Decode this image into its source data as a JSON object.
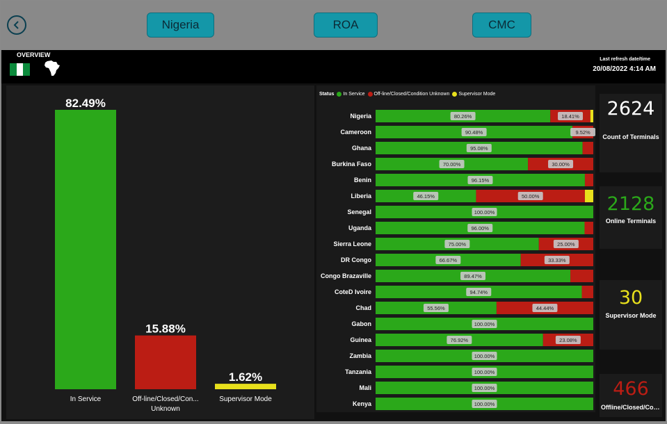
{
  "nav": {
    "buttons": [
      {
        "label": "Nigeria"
      },
      {
        "label": "ROA"
      },
      {
        "label": "CMC"
      }
    ]
  },
  "header": {
    "title": "OVERVIEW",
    "refresh_label": "Last refresh date/time",
    "refresh_value": "20/08/2022 4:14 AM"
  },
  "colors": {
    "in_service": "#2ba81a",
    "offline": "#bb1d14",
    "supervisor": "#e8e01c",
    "flag_green": "#0c8a3c",
    "background": "#111111"
  },
  "chart_data": [
    {
      "type": "bar",
      "categories": [
        "In Service",
        "Off-line/Closed/Con... Unknown",
        "Supervisor Mode"
      ],
      "values": [
        82.49,
        15.88,
        1.62
      ],
      "value_labels": [
        "82.49%",
        "15.88%",
        "1.62%"
      ]
    },
    {
      "type": "bar",
      "orientation": "horizontal",
      "stacked": true,
      "legend_title": "Status",
      "legend_position": "top-left",
      "xlim": [
        0,
        100
      ],
      "categories": [
        "Nigeria",
        "Cameroon",
        "Ghana",
        "Burkina Faso",
        "Benin",
        "Liberia",
        "Senegal",
        "Uganda",
        "Sierra Leone",
        "DR Congo",
        "Congo Brazaville",
        "CoteD Ivoire",
        "Chad",
        "Gabon",
        "Guinea",
        "Zambia",
        "Tanzania",
        "Mali",
        "Kenya"
      ],
      "series": [
        {
          "name": "In Service",
          "values": [
            80.26,
            90.48,
            95.08,
            70.0,
            96.15,
            46.15,
            100.0,
            96.0,
            75.0,
            66.67,
            89.47,
            94.74,
            55.56,
            100.0,
            76.92,
            100.0,
            100.0,
            100.0,
            100.0
          ]
        },
        {
          "name": "Off-line/Closed/Condition Unknown",
          "values": [
            18.41,
            9.52,
            4.92,
            30.0,
            3.85,
            50.0,
            0,
            4.0,
            25.0,
            33.33,
            10.53,
            5.26,
            44.44,
            0,
            23.08,
            0,
            0,
            0,
            0
          ]
        },
        {
          "name": "Supervisor Mode",
          "values": [
            1.33,
            0,
            0,
            0,
            0,
            3.85,
            0,
            0,
            0,
            0,
            0,
            0,
            0,
            0,
            0,
            0,
            0,
            0,
            0
          ]
        }
      ],
      "data_labels": {
        "In Service": [
          "80.26%",
          "90.48%",
          "95.08%",
          "70.00%",
          "96.15%",
          "46.15%",
          "100.00%",
          "96.00%",
          "75.00%",
          "66.67%",
          "89.47%",
          "94.74%",
          "55.56%",
          "100.00%",
          "76.92%",
          "100.00%",
          "100.00%",
          "100.00%",
          "100.00%"
        ],
        "Off-line/Closed/Condition Unknown": [
          "18.41%",
          "9.52%",
          "",
          "30.00%",
          "",
          "50.00%",
          "",
          "",
          "25.00%",
          "33.33%",
          "",
          "",
          "44.44%",
          "",
          "23.08%",
          "",
          "",
          "",
          ""
        ]
      }
    }
  ],
  "cards": [
    {
      "value": "2624",
      "label": "Count of Terminals",
      "color": "#ffffff"
    },
    {
      "value": "2128",
      "label": "Online Terminals",
      "color": "#2ba81a"
    },
    {
      "value": "30",
      "label": "Supervisor Mode",
      "color": "#e8e01c"
    },
    {
      "value": "466",
      "label": "Offline/Closed/Condition Unknown",
      "color": "#bb1d14"
    }
  ]
}
